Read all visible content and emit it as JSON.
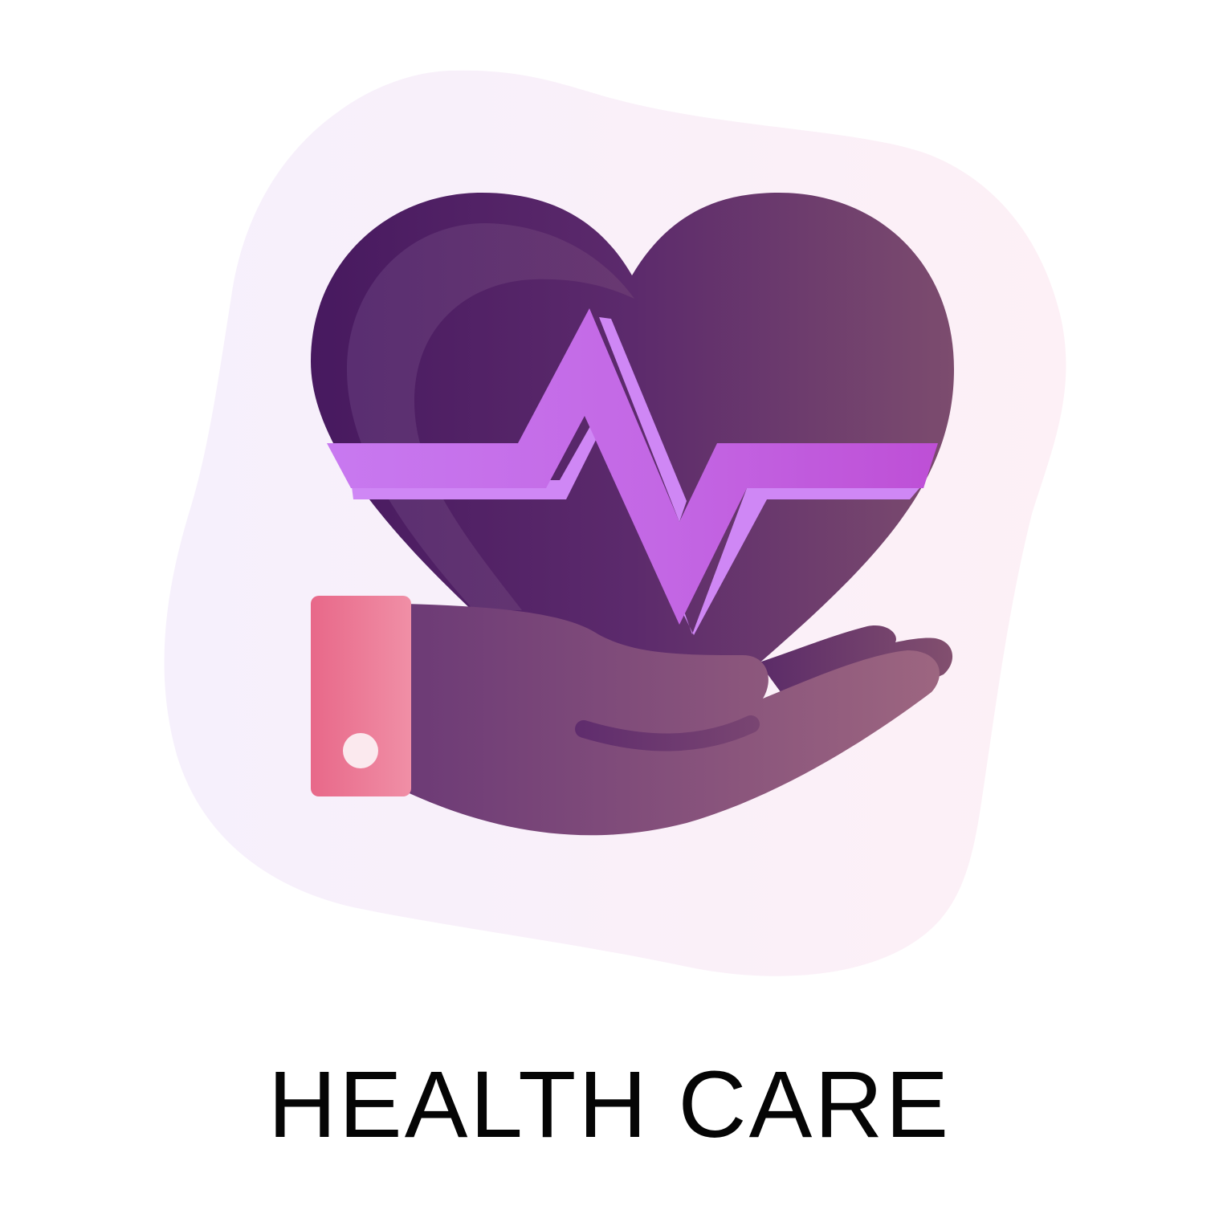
{
  "caption": "HEALTH CARE",
  "icons": {
    "background": "blob-background",
    "heart": "heart-icon",
    "pulse": "heartbeat-pulse-icon",
    "hand": "open-hand-icon",
    "cuff": "sleeve-cuff-icon"
  },
  "colors": {
    "blob_left": "#f6f0fc",
    "blob_right": "#fdf0f6",
    "heart_dark": "#47195f",
    "heart_mid": "#5c2a6c",
    "heart_right": "#7c4c6e",
    "pulse_light": "#cf87f5",
    "pulse_main": "#c367e4",
    "pulse_right": "#be4fd6",
    "hand_left": "#6c3a76",
    "hand_right": "#9d6680",
    "cuff_left": "#e86889",
    "cuff_right": "#f08fa6",
    "caption": "#050505"
  }
}
